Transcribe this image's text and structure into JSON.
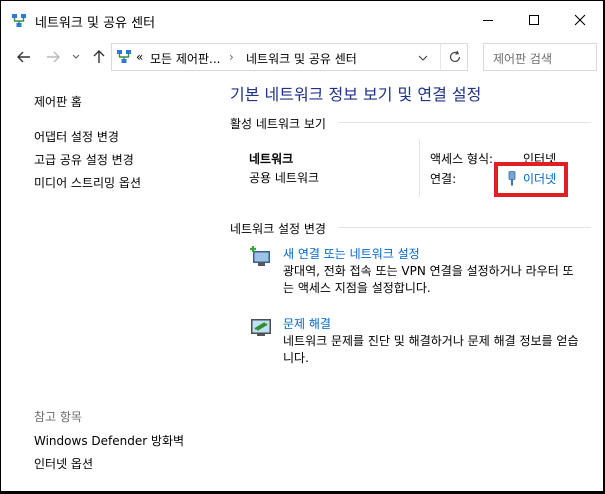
{
  "window": {
    "title": "네트워크 및 공유 센터",
    "icon": "network-icon"
  },
  "address": {
    "overflow": "«",
    "segments": [
      "모든 제어판...",
      "네트워크 및 공유 센터"
    ],
    "separator": "›",
    "search_placeholder": "제어판 검색"
  },
  "sidebar": {
    "home": "제어판 홈",
    "links": [
      "어댑터 설정 변경",
      "고급 공유 설정 변경",
      "미디어 스트리밍 옵션"
    ],
    "see_also_title": "참고 항목",
    "see_also": [
      "Windows Defender 방화벽",
      "인터넷 옵션"
    ]
  },
  "main": {
    "title": "기본 네트워크 정보 보기 및 연결 설정",
    "active_section": "활성 네트워크 보기",
    "network": {
      "name": "네트워크",
      "type": "공용 네트워크",
      "access_label": "액세스 형식:",
      "access_value": "인터넷",
      "connection_label": "연결:",
      "connection_value": "이더넷"
    },
    "change_section": "네트워크 설정 변경",
    "tasks": [
      {
        "title": "새 연결 또는 네트워크 설정",
        "desc": "광대역, 전화 접속 또는 VPN 연결을 설정하거나 라우터 또는 액세스 지점을 설정합니다.",
        "icon": "new-connection-icon"
      },
      {
        "title": "문제 해결",
        "desc": "네트워크 문제를 진단 및 해결하거나 문제 해결 정보를 얻습니다.",
        "icon": "troubleshoot-icon"
      }
    ]
  },
  "colors": {
    "link": "#0066cc",
    "title": "#1e3287",
    "highlight": "#e02020"
  }
}
